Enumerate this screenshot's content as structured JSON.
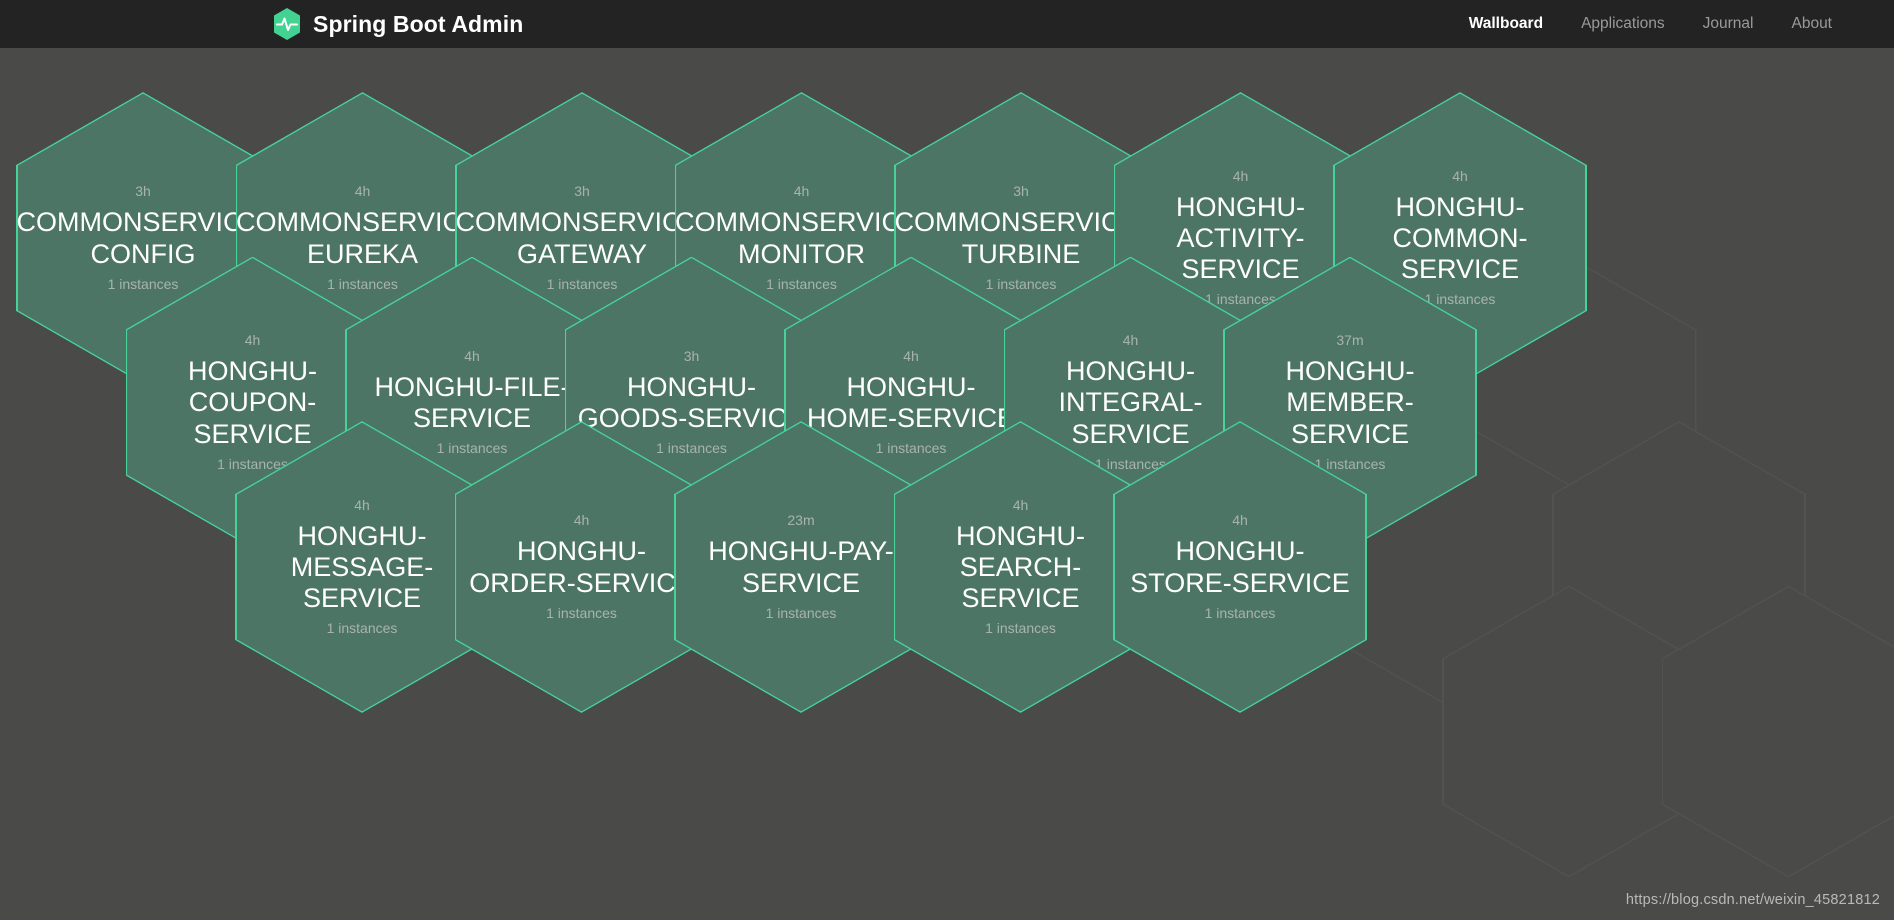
{
  "header": {
    "brand_title": "Spring Boot Admin",
    "brand_logo_icon": "heartbeat-hexagon-logo",
    "accent_color": "#42d392",
    "background_color": "#232323",
    "nav": [
      {
        "label": "Wallboard",
        "active": true
      },
      {
        "label": "Applications",
        "active": false
      },
      {
        "label": "Journal",
        "active": false
      },
      {
        "label": "About",
        "active": false
      }
    ]
  },
  "wallboard": {
    "background_color": "#4a4a48",
    "hex_fill_color": "#4d7565",
    "hex_border_color": "#45d39a",
    "applications": [
      {
        "name": "COMMONSERVICE-CONFIG",
        "name_lines": [
          "COMMONSERVICE-",
          "CONFIG"
        ],
        "uptime": "3h",
        "instances": "1 instances",
        "row": 0,
        "col": 0
      },
      {
        "name": "COMMONSERVICE-EUREKA",
        "name_lines": [
          "COMMONSERVICE-",
          "EUREKA"
        ],
        "uptime": "4h",
        "instances": "1 instances",
        "row": 0,
        "col": 1
      },
      {
        "name": "COMMONSERVICE-GATEWAY",
        "name_lines": [
          "COMMONSERVICE-",
          "GATEWAY"
        ],
        "uptime": "3h",
        "instances": "1 instances",
        "row": 0,
        "col": 2
      },
      {
        "name": "COMMONSERVICE-MONITOR",
        "name_lines": [
          "COMMONSERVICE-",
          "MONITOR"
        ],
        "uptime": "4h",
        "instances": "1 instances",
        "row": 0,
        "col": 3
      },
      {
        "name": "COMMONSERVICE-TURBINE",
        "name_lines": [
          "COMMONSERVICE-",
          "TURBINE"
        ],
        "uptime": "3h",
        "instances": "1 instances",
        "row": 0,
        "col": 4
      },
      {
        "name": "HONGHU-ACTIVITY-SERVICE",
        "name_lines": [
          "HONGHU-",
          "ACTIVITY-",
          "SERVICE"
        ],
        "uptime": "4h",
        "instances": "1 instances",
        "row": 0,
        "col": 5
      },
      {
        "name": "HONGHU-COMMON-SERVICE",
        "name_lines": [
          "HONGHU-",
          "COMMON-",
          "SERVICE"
        ],
        "uptime": "4h",
        "instances": "1 instances",
        "row": 0,
        "col": 6
      },
      {
        "name": "HONGHU-COUPON-SERVICE",
        "name_lines": [
          "HONGHU-",
          "COUPON-",
          "SERVICE"
        ],
        "uptime": "4h",
        "instances": "1 instances",
        "row": 1,
        "col": 0
      },
      {
        "name": "HONGHU-FILE-SERVICE",
        "name_lines": [
          "HONGHU-FILE-",
          "SERVICE"
        ],
        "uptime": "4h",
        "instances": "1 instances",
        "row": 1,
        "col": 1
      },
      {
        "name": "HONGHU-GOODS-SERVICE",
        "name_lines": [
          "HONGHU-",
          "GOODS-SERVICE"
        ],
        "uptime": "3h",
        "instances": "1 instances",
        "row": 1,
        "col": 2
      },
      {
        "name": "HONGHU-HOME-SERVICE",
        "name_lines": [
          "HONGHU-",
          "HOME-SERVICE"
        ],
        "uptime": "4h",
        "instances": "1 instances",
        "row": 1,
        "col": 3
      },
      {
        "name": "HONGHU-INTEGRAL-SERVICE",
        "name_lines": [
          "HONGHU-",
          "INTEGRAL-",
          "SERVICE"
        ],
        "uptime": "4h",
        "instances": "1 instances",
        "row": 1,
        "col": 4
      },
      {
        "name": "HONGHU-MEMBER-SERVICE",
        "name_lines": [
          "HONGHU-",
          "MEMBER-",
          "SERVICE"
        ],
        "uptime": "37m",
        "instances": "1 instances",
        "row": 1,
        "col": 5
      },
      {
        "name": "HONGHU-MESSAGE-SERVICE",
        "name_lines": [
          "HONGHU-",
          "MESSAGE-",
          "SERVICE"
        ],
        "uptime": "4h",
        "instances": "1 instances",
        "row": 2,
        "col": 0
      },
      {
        "name": "HONGHU-ORDER-SERVICE",
        "name_lines": [
          "HONGHU-",
          "ORDER-SERVICE"
        ],
        "uptime": "4h",
        "instances": "1 instances",
        "row": 2,
        "col": 1
      },
      {
        "name": "HONGHU-PAY-SERVICE",
        "name_lines": [
          "HONGHU-PAY-",
          "SERVICE"
        ],
        "uptime": "23m",
        "instances": "1 instances",
        "row": 2,
        "col": 2
      },
      {
        "name": "HONGHU-SEARCH-SERVICE",
        "name_lines": [
          "HONGHU-",
          "SEARCH-",
          "SERVICE"
        ],
        "uptime": "4h",
        "instances": "1 instances",
        "row": 2,
        "col": 3
      },
      {
        "name": "HONGHU-STORE-SERVICE",
        "name_lines": [
          "HONGHU-",
          "STORE-SERVICE"
        ],
        "uptime": "4h",
        "instances": "1 instances",
        "row": 2,
        "col": 4
      }
    ],
    "empty_slots": [
      {
        "row": 1,
        "col": 6
      },
      {
        "row": 2,
        "col": 5
      },
      {
        "row": 2,
        "col": 6
      },
      {
        "row": 3,
        "col": 5
      },
      {
        "row": 3,
        "col": 6
      }
    ]
  },
  "watermark": {
    "text": "https://blog.csdn.net/weixin_45821812"
  }
}
